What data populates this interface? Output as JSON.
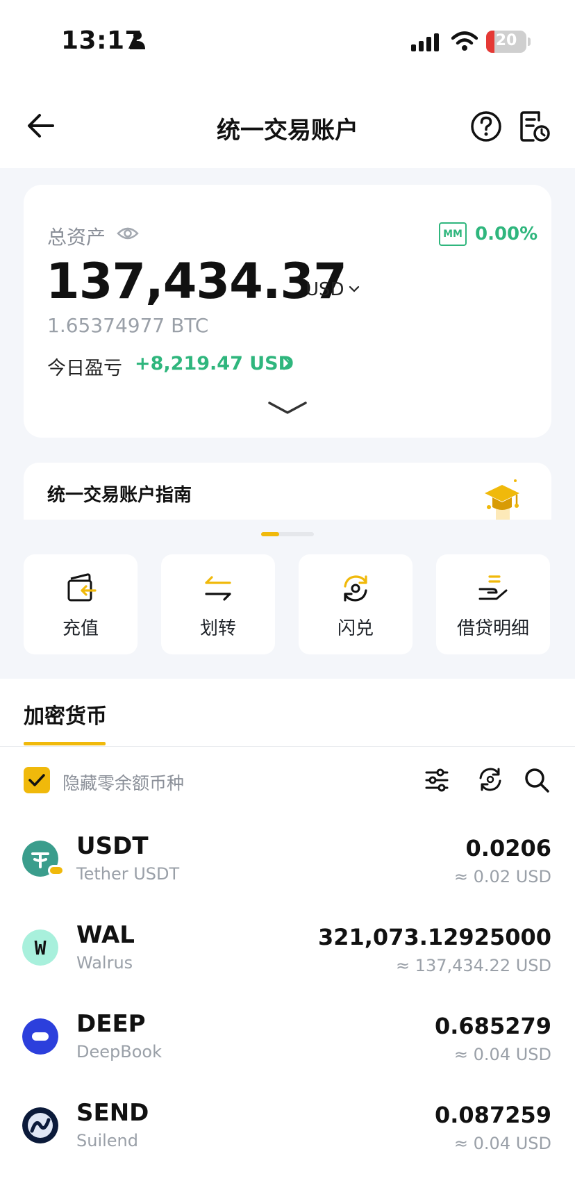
{
  "status_bar": {
    "time": "13:17",
    "battery": "20",
    "battery_level": 0.2
  },
  "header": {
    "title": "统一交易账户"
  },
  "asset_card": {
    "total_label": "总资产",
    "mm_badge": "MM",
    "mm_value": "0.00%",
    "total_amount": "137,434.37",
    "currency": "USD",
    "btc_value": "1.65374977 BTC",
    "pnl_label": "今日盈亏",
    "pnl_value": "+8,219.47 USD"
  },
  "guide": {
    "text": "统一交易账户指南"
  },
  "actions": [
    {
      "label": "充值",
      "icon": "wallet-deposit-icon"
    },
    {
      "label": "划转",
      "icon": "transfer-icon"
    },
    {
      "label": "闪兑",
      "icon": "convert-icon"
    },
    {
      "label": "借贷明细",
      "icon": "loan-detail-icon"
    }
  ],
  "tabs": {
    "crypto": "加密货币"
  },
  "filter": {
    "hide_zero": "隐藏零余额币种",
    "hide_zero_checked": true
  },
  "coins": [
    {
      "symbol": "USDT",
      "name": "Tether USDT",
      "amount": "0.0206",
      "usd": "≈ 0.02 USD",
      "color": "#3a9d8c"
    },
    {
      "symbol": "WAL",
      "name": "Walrus",
      "amount": "321,073.12925000",
      "usd": "≈ 137,434.22 USD",
      "color": "#a8f0dc"
    },
    {
      "symbol": "DEEP",
      "name": "DeepBook",
      "amount": "0.685279",
      "usd": "≈ 0.04 USD",
      "color": "#2c3fdc"
    },
    {
      "symbol": "SEND",
      "name": "Suilend",
      "amount": "0.087259",
      "usd": "≈ 0.04 USD",
      "color": "#0b1a3a"
    }
  ],
  "colors": {
    "accent": "#f0b90b",
    "positive": "#2fb67d",
    "muted": "#9aa0a8",
    "page_gray": "#f4f6fa"
  }
}
